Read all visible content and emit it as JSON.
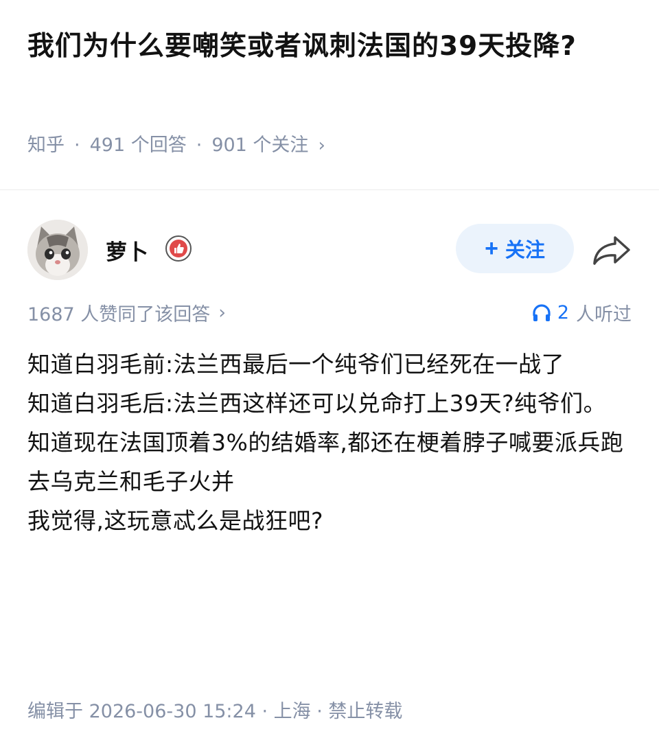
{
  "question": {
    "title": "我们为什么要嘲笑或者讽刺法国的39天投降?",
    "source": "知乎",
    "answers": "491 个回答",
    "followers": "901 个关注",
    "chevron": "›"
  },
  "answer": {
    "author_name": "萝卜",
    "follow_button": "关注",
    "follow_plus": "+",
    "likes_text": "1687 人赞同了该回答",
    "likes_chevron": "›",
    "listened_count": "2",
    "listened_label": "人听过",
    "content_lines": [
      "知道白羽毛前:法兰西最后一个纯爷们已经死在一战了",
      "知道白羽毛后:法兰西这样还可以兑命打上39天?纯爷们。",
      "知道现在法国顶着3%的结婚率,都还在梗着脖子喊要派兵跑去乌克兰和毛子火并",
      "我觉得,这玩意忒么是战狂吧?"
    ],
    "footer": "编辑于 2026-06-30 15:24 · 上海 · 禁止转载"
  },
  "colors": {
    "accent": "#1772f6",
    "meta_gray": "#8590a6",
    "follow_bg": "#ebf3fc",
    "badge_red": "#e04a4a"
  },
  "icons": {
    "share": "share-icon",
    "headphone": "headphone-icon",
    "badge": "badge-icon",
    "avatar": "cat-avatar"
  }
}
